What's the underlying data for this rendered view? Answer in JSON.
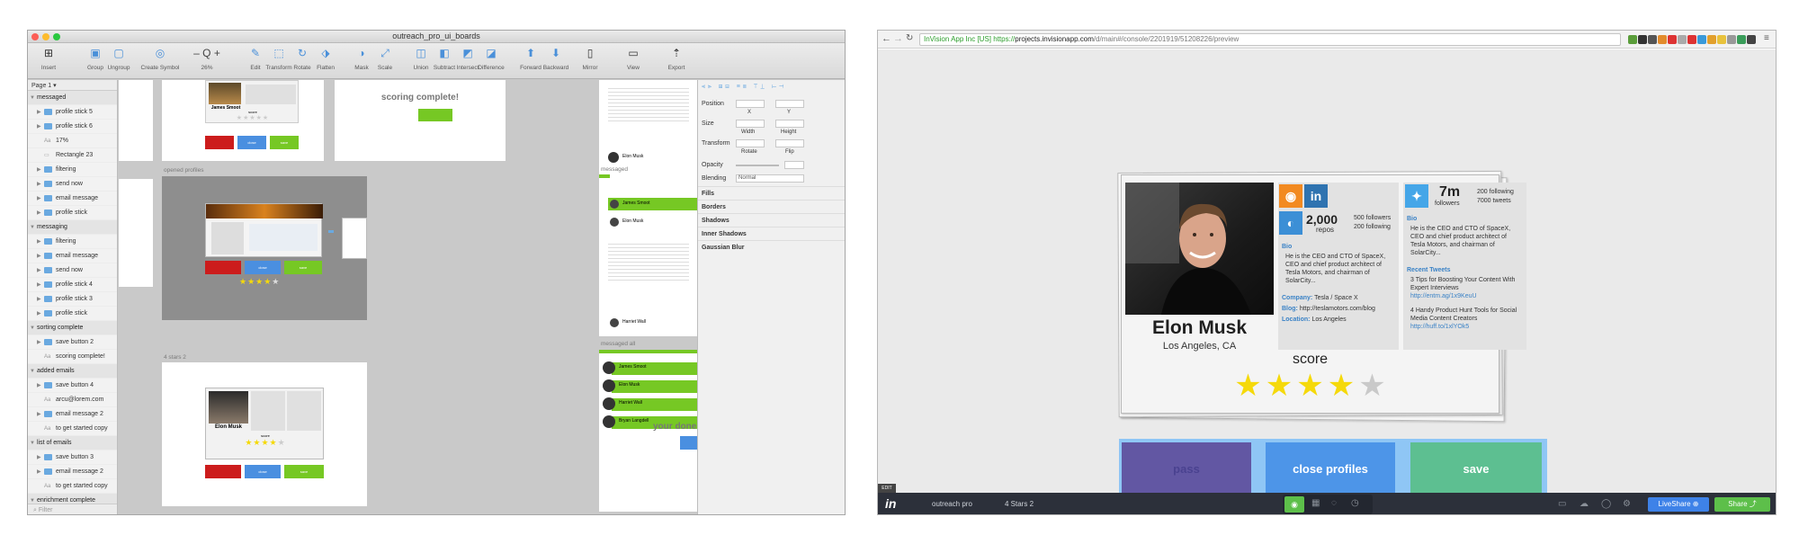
{
  "sketch": {
    "window_title": "outreach_pro_ui_boards",
    "toolbar": [
      {
        "icon": "insert-icon",
        "label": "Insert"
      },
      {
        "icon": "group-icon",
        "label": "Group"
      },
      {
        "icon": "ungroup-icon",
        "label": "Ungroup"
      },
      {
        "icon": "create-symbol-icon",
        "label": "Create Symbol"
      },
      {
        "icon": "zoom-icon",
        "label": "26%"
      },
      {
        "icon": "edit-icon",
        "label": "Edit"
      },
      {
        "icon": "transform-icon",
        "label": "Transform"
      },
      {
        "icon": "rotate-icon",
        "label": "Rotate"
      },
      {
        "icon": "flatten-icon",
        "label": "Flatten"
      },
      {
        "icon": "mask-icon",
        "label": "Mask"
      },
      {
        "icon": "scale-icon",
        "label": "Scale"
      },
      {
        "icon": "union-icon",
        "label": "Union"
      },
      {
        "icon": "subtract-icon",
        "label": "Subtract"
      },
      {
        "icon": "intersect-icon",
        "label": "Intersect"
      },
      {
        "icon": "difference-icon",
        "label": "Difference"
      },
      {
        "icon": "forward-icon",
        "label": "Forward"
      },
      {
        "icon": "backward-icon",
        "label": "Backward"
      },
      {
        "icon": "mirror-icon",
        "label": "Mirror"
      },
      {
        "icon": "view-icon",
        "label": "View"
      },
      {
        "icon": "export-icon",
        "label": "Export"
      }
    ],
    "zoom_prefix": "– Q +",
    "page_selector": "Page 1 ▾",
    "layers": [
      {
        "type": "group",
        "label": "messaged"
      },
      {
        "type": "folder",
        "label": "profile stick 5"
      },
      {
        "type": "folder",
        "label": "profile stick 6"
      },
      {
        "type": "text",
        "label": "17%"
      },
      {
        "type": "shape",
        "label": "Rectangle 23"
      },
      {
        "type": "folder",
        "label": "filtering"
      },
      {
        "type": "folder",
        "label": "send now"
      },
      {
        "type": "folder",
        "label": "email message"
      },
      {
        "type": "folder",
        "label": "profile stick"
      },
      {
        "type": "group",
        "label": "messaging"
      },
      {
        "type": "folder",
        "label": "filtering"
      },
      {
        "type": "folder",
        "label": "email message"
      },
      {
        "type": "folder",
        "label": "send now"
      },
      {
        "type": "folder",
        "label": "profile stick 4"
      },
      {
        "type": "folder",
        "label": "profile stick 3"
      },
      {
        "type": "folder",
        "label": "profile stick"
      },
      {
        "type": "group",
        "label": "sorting complete"
      },
      {
        "type": "folder",
        "label": "save button 2"
      },
      {
        "type": "text",
        "label": "scoring complete!"
      },
      {
        "type": "group",
        "label": "added emails"
      },
      {
        "type": "folder",
        "label": "save button 4"
      },
      {
        "type": "text",
        "label": "arcu@lorem.com"
      },
      {
        "type": "folder",
        "label": "email message 2"
      },
      {
        "type": "text",
        "label": "to get started copy"
      },
      {
        "type": "group",
        "label": "list of emails"
      },
      {
        "type": "folder",
        "label": "save button 3"
      },
      {
        "type": "folder",
        "label": "email message 2"
      },
      {
        "type": "text",
        "label": "to get started copy"
      },
      {
        "type": "group",
        "label": "enrichment complete"
      }
    ],
    "filter_placeholder": "Filter",
    "canvas": {
      "label_opened_profiles": "opened profiles",
      "label_4_stars_2": "4 stars 2",
      "label_messaged": "messaged",
      "label_messaged_all": "messaged all",
      "scoring_complete": "scoring complete!",
      "your_done": "your done!",
      "mini_name": "Elon Musk",
      "mini_name_top": "James Smoot",
      "mini_score": "score",
      "list_names": [
        "James Smoot",
        "Elon Musk",
        "Harriet Wall",
        "Bryan Langdell"
      ]
    },
    "inspector": {
      "position": "Position",
      "x": "X",
      "y": "Y",
      "size": "Size",
      "width": "Width",
      "height": "Height",
      "transform": "Transform",
      "rotate": "Rotate",
      "flip": "Flip",
      "opacity": "Opacity",
      "blending": "Blending",
      "blending_value": "Normal",
      "fills": "Fills",
      "borders": "Borders",
      "shadows": "Shadows",
      "inner_shadows": "Inner Shadows",
      "gaussian_blur": "Gaussian Blur"
    }
  },
  "browser": {
    "url_secure": "InVision App Inc [US]",
    "url_proto": "https://",
    "url_host": "projects.invisionapp.com",
    "url_path": "/d/main#/console/2201919/51208226/preview",
    "profile": {
      "name": "Elon Musk",
      "location": "Los Angeles, CA",
      "repos": "2,000",
      "repos_label": "repos",
      "followers": "500 followers",
      "following": "200 following",
      "bio_label": "Bio",
      "bio": "He is the CEO and CTO of SpaceX, CEO and chief product architect of Tesla Motors, and chairman of SolarCity...",
      "company_label": "Company:",
      "company": "Tesla / Space X",
      "blog_label": "Blog:",
      "blog": "http://teslamotors.com/blog",
      "location_label": "Location:",
      "location_value": "Los Angeles",
      "tw_followers": "7m",
      "tw_followers_label": "followers",
      "tw_following": "200 following",
      "tw_tweets": "7000 tweets",
      "tw_bio_label": "Bio",
      "tw_bio": "He is the CEO and CTO of SpaceX, CEO and chief product architect of Tesla Motors, and chairman of SolarCity...",
      "recent_tweets_label": "Recent Tweets",
      "tweet1": "3 Tips for Boosting Your Content With Expert Interviews",
      "tweet1_link": "http://entm.ag/1x9KeuU",
      "tweet2": "4 Handy Product Hunt Tools for Social Media Content Creators",
      "tweet2_link": "http://huff.to/1xlYOk5",
      "score_label": "score",
      "score": 4,
      "score_max": 5
    },
    "buttons": {
      "pass": "pass",
      "close_profiles": "close profiles",
      "save": "save"
    },
    "invision": {
      "logo": "in",
      "project": "outreach pro",
      "screen": "4 Stars 2",
      "tag": "EDIT",
      "liveshare": "LiveShare",
      "share": "Share"
    },
    "colors": {
      "pass": "#6257a3",
      "close": "#4d95e8",
      "save": "#5dbf91",
      "star_on": "#f5d90a",
      "star_off": "#c9c9c9",
      "rss": "#f28a21",
      "linkedin": "#2f73b0",
      "github": "#3c8fd6",
      "twitter": "#45a6e8"
    }
  }
}
